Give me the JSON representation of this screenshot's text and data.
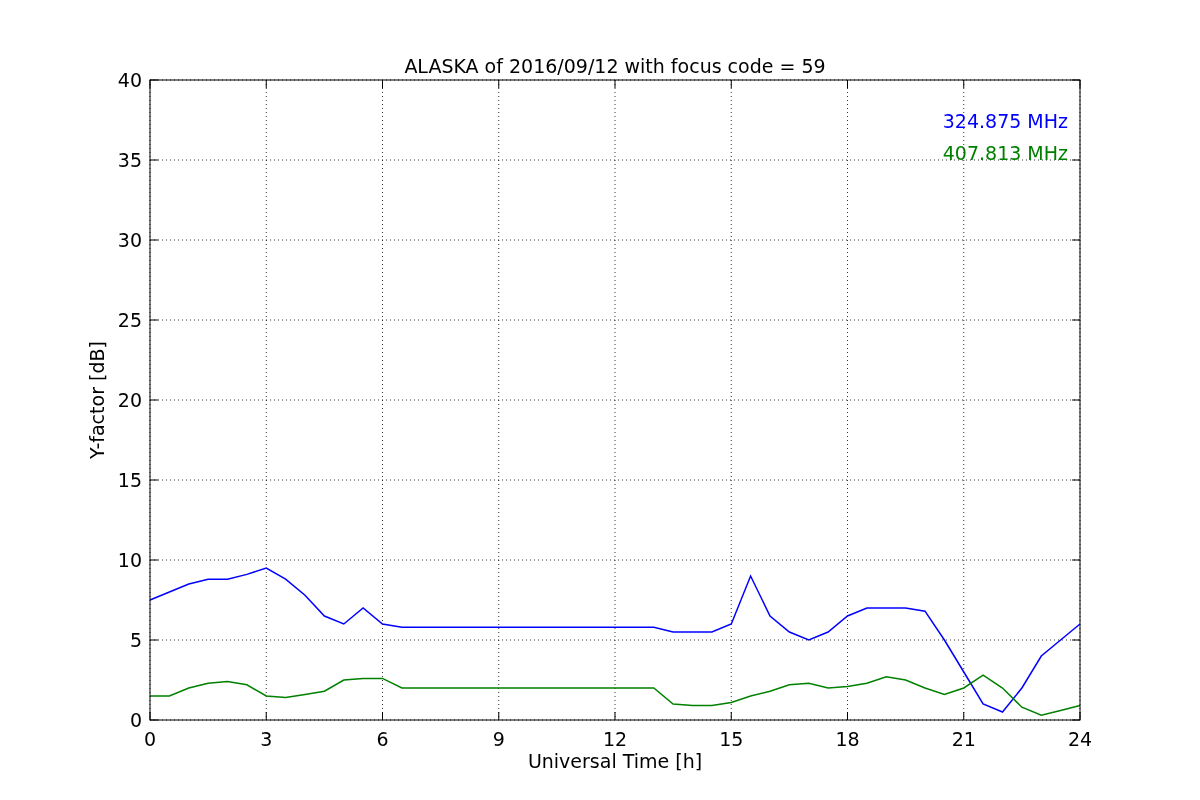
{
  "figure": {
    "chart_data": {
      "type": "line",
      "title": "ALASKA of 2016/09/12 with focus code = 59",
      "xlabel": "Universal Time [h]",
      "ylabel": "Y-factor [dB]",
      "x": [
        0,
        0.5,
        1,
        1.5,
        2,
        2.5,
        3,
        3.5,
        4,
        4.5,
        5,
        5.5,
        6,
        6.5,
        7,
        7.5,
        8,
        8.5,
        9,
        9.5,
        10,
        10.5,
        11,
        11.5,
        12,
        12.5,
        13,
        13.5,
        14,
        14.5,
        15,
        15.5,
        16,
        16.5,
        17,
        17.5,
        18,
        18.5,
        19,
        19.5,
        20,
        20.5,
        21,
        21.5,
        22,
        22.5,
        23,
        23.5,
        24
      ],
      "series": [
        {
          "name": "324.875 MHz",
          "color": "#0000ff",
          "values": [
            7.5,
            8,
            8.5,
            8.8,
            8.8,
            9.1,
            9.5,
            8.8,
            7.8,
            6.5,
            6,
            7,
            6,
            5.8,
            5.8,
            5.8,
            5.8,
            5.8,
            5.8,
            5.8,
            5.8,
            5.8,
            5.8,
            5.8,
            5.8,
            5.8,
            5.8,
            5.5,
            5.5,
            5.5,
            6,
            9,
            6.5,
            5.5,
            5,
            5.5,
            6.5,
            7,
            7,
            7,
            6.8,
            5,
            3,
            1,
            0.5,
            2,
            4,
            5,
            6
          ]
        },
        {
          "name": "407.813 MHz",
          "color": "#008000",
          "values": [
            1.5,
            1.5,
            2,
            2.3,
            2.4,
            2.2,
            1.5,
            1.4,
            1.6,
            1.8,
            2.5,
            2.6,
            2.6,
            2,
            2,
            2,
            2,
            2,
            2,
            2,
            2,
            2,
            2,
            2,
            2,
            2,
            2,
            1,
            0.9,
            0.9,
            1.1,
            1.5,
            1.8,
            2.2,
            2.3,
            2,
            2.1,
            2.3,
            2.7,
            2.5,
            2,
            1.6,
            2,
            2.8,
            2,
            0.8,
            0.3,
            0.6,
            0.9
          ]
        }
      ],
      "grid": true,
      "xlim": [
        0,
        24
      ],
      "ylim": [
        0,
        40
      ],
      "xticks": [
        0,
        3,
        6,
        9,
        12,
        15,
        18,
        21,
        24
      ],
      "yticks": [
        0,
        5,
        10,
        15,
        20,
        25,
        30,
        35,
        40
      ]
    }
  }
}
